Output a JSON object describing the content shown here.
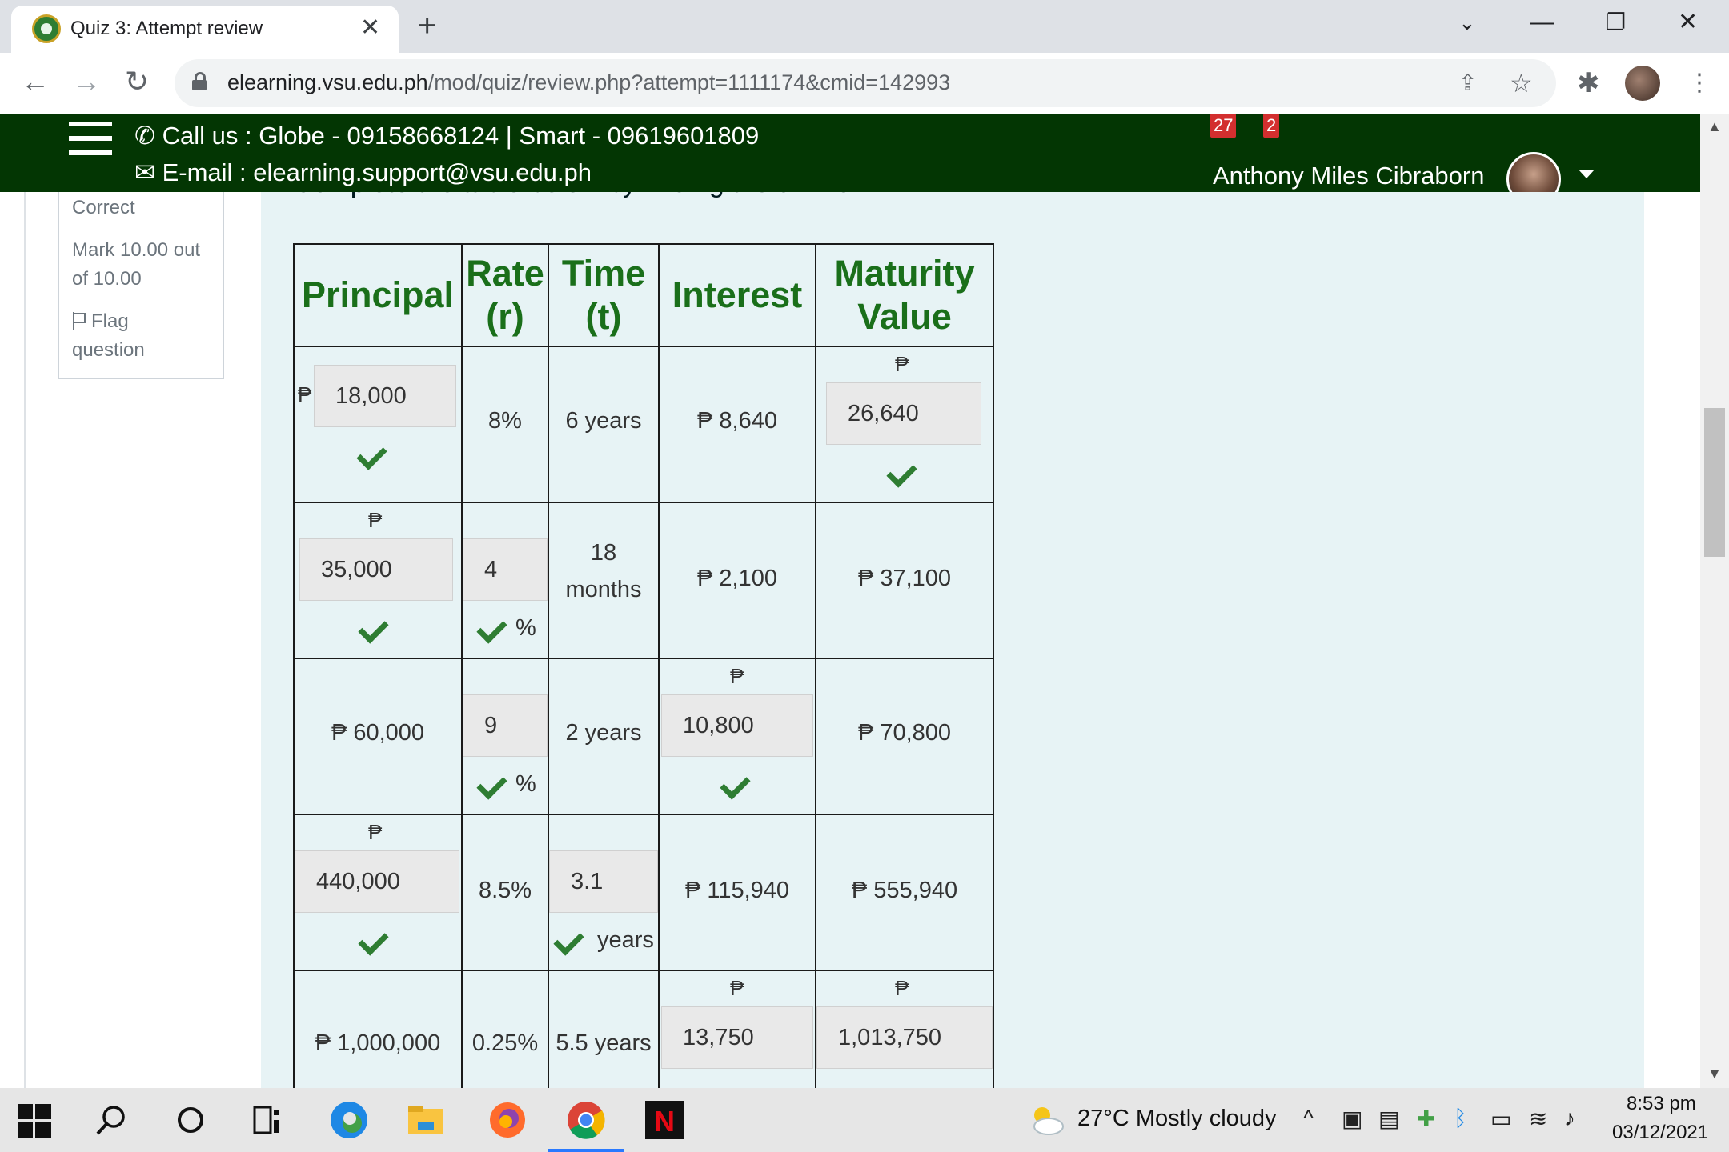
{
  "browser": {
    "tab_title": "Quiz 3: Attempt review",
    "url_host": "elearning.vsu.edu.ph",
    "url_path": "/mod/quiz/review.php?attempt=1111174&cmid=142993"
  },
  "header": {
    "call_line": "Call us : Globe - 09158668124 | Smart - 09619601809",
    "email_line": "E-mail : elearning.support@vsu.edu.ph",
    "notif_count": "27",
    "msg_count": "2",
    "user_name": "Anthony Miles Cibraborn"
  },
  "question_info": {
    "status": "Correct",
    "mark_line1": "Mark 10.00 out",
    "mark_line2": "of 10.00",
    "flag_line1": "Flag",
    "flag_line2": "question"
  },
  "question": {
    "cut_text": "Complete the table below by finding the unknown."
  },
  "table": {
    "headers": {
      "principal": "Principal",
      "rate_1": "Rate",
      "rate_2": "(r)",
      "time_1": "Time",
      "time_2": "(t)",
      "interest": "Interest",
      "maturity_1": "Maturity",
      "maturity_2": "Value"
    },
    "peso": "₱",
    "percent": "%",
    "years_unit": "years",
    "rows": [
      {
        "principal": "18,000",
        "rate": "8%",
        "time": "6 years",
        "interest": "₱ 8,640",
        "maturity": "26,640"
      },
      {
        "principal": "35,000",
        "rate": "4",
        "time_1": "18",
        "time_2": "months",
        "interest": "₱ 2,100",
        "maturity": "₱ 37,100"
      },
      {
        "principal": "₱ 60,000",
        "rate": "9",
        "time": "2 years",
        "interest": "10,800",
        "maturity": "₱ 70,800"
      },
      {
        "principal": "440,000",
        "rate": "8.5%",
        "time": "3.1",
        "interest": "₱ 115,940",
        "maturity": "₱ 555,940"
      },
      {
        "principal": "₱ 1,000,000",
        "rate": "0.25%",
        "time": "5.5 years",
        "interest": "13,750",
        "maturity": "1,013,750"
      }
    ]
  },
  "taskbar": {
    "weather": "27°C  Mostly cloudy",
    "time": "8:53 pm",
    "date": "03/12/2021"
  },
  "colors": {
    "header_green": "#033603",
    "table_header_green": "#1a6f1a",
    "check_green": "#2e7d32",
    "panel_bg": "#e7f3f5"
  }
}
